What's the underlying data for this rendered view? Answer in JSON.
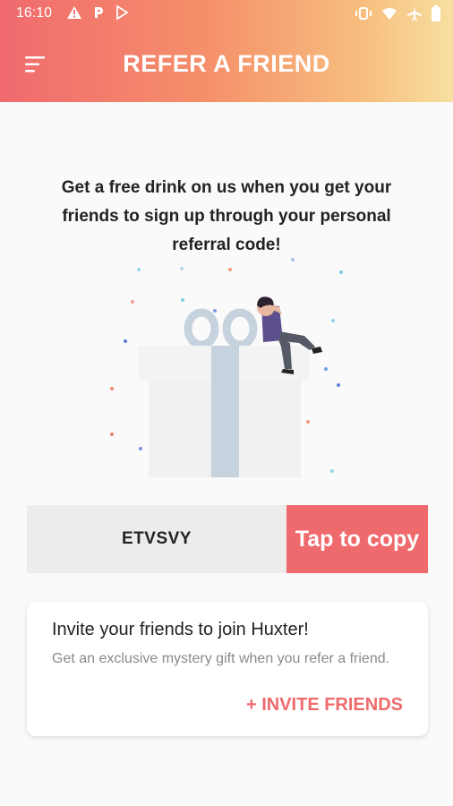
{
  "status_bar": {
    "time": "16:10",
    "left_icons": [
      "warning-icon",
      "parking-icon",
      "play-store-icon"
    ],
    "right_icons": [
      "vibrate-icon",
      "wifi-icon",
      "airplane-icon",
      "battery-icon"
    ]
  },
  "header": {
    "title": "REFER A FRIEND",
    "menu_icon": "menu-icon",
    "gradient_colors": [
      "#f06a6e",
      "#f7dfa0"
    ]
  },
  "intro": {
    "text": "Get a free drink on us when you get your friends to sign up through your personal referral code!"
  },
  "illustration": {
    "icon": "gift-box-illustration"
  },
  "referral": {
    "code": "ETVSVY",
    "copy_label": "Tap to copy"
  },
  "invite_card": {
    "title": "Invite your friends to join Huxter!",
    "description": "Get an exclusive mystery gift when you refer a friend.",
    "button_label": "+ INVITE FRIENDS"
  },
  "colors": {
    "accent": "#ee6a6d",
    "code_bg": "#ececec",
    "page_bg": "#fafafa"
  }
}
